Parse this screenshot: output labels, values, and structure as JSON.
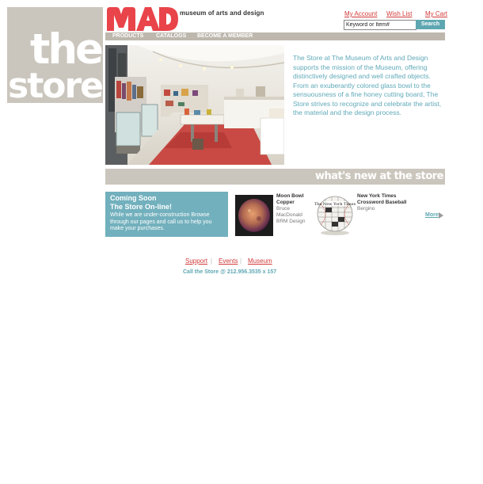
{
  "brand": {
    "line1": "the",
    "line2": "store"
  },
  "logo": {
    "letters": "MAD",
    "name": "museum of arts and design"
  },
  "header_links": {
    "account": "My Account",
    "wishlist": "Wish List",
    "cart": "My Cart"
  },
  "search": {
    "value": "Keyword or Item#",
    "button": "Search"
  },
  "nav": [
    "PRODUCTS",
    "CATALOGS",
    "BECOME A MEMBER"
  ],
  "intro_text": "The Store at The Museum of Arts and Design supports the mission of the Museum, offering distinctively designed and well crafted objects. From an exuberantly colored glass bowl to the sensuousness of a fine honey cutting board, The Store strives to recognize and celebrate the artist, the material and the design process.",
  "whats_new": "what's new at the store",
  "coming_soon": {
    "line1": "Coming Soon",
    "line2": "The Store On-line!",
    "body": "While we are under-construction Browse through our pages and call us to help you make your purchases."
  },
  "products": [
    {
      "name1": "Moon Bowl",
      "name2": "Copper",
      "maker": [
        "Bruce",
        "MacDonald",
        "BRM Design"
      ]
    },
    {
      "name1": "New York Times",
      "name2": "Crossword Baseball",
      "maker": [
        "Bergino"
      ]
    }
  ],
  "more": "More",
  "footer": {
    "links": [
      "Support",
      "Events",
      "Museum"
    ],
    "separator": "|",
    "phone": "Call the Store @ 212.956.3535 x 157"
  },
  "colors": {
    "accent_red": "#d23a3a",
    "teal": "#5ea7b2",
    "taupe": "#cbc6bd"
  }
}
